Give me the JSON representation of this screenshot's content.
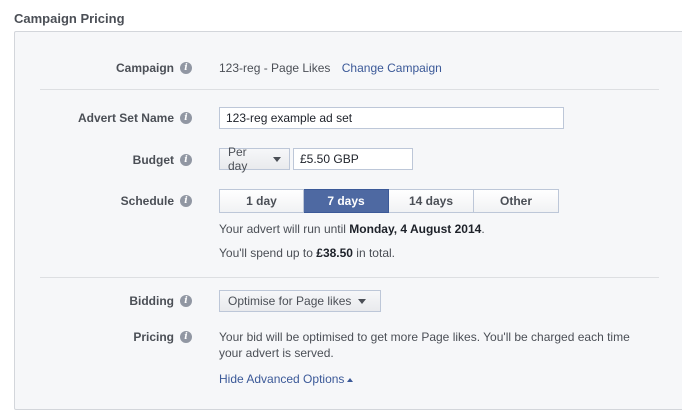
{
  "section_title": "Campaign Pricing",
  "campaign": {
    "label": "Campaign",
    "value": "123-reg - Page Likes",
    "change_link": "Change Campaign"
  },
  "advert_set": {
    "label": "Advert Set Name",
    "value": "123-reg example ad set"
  },
  "budget": {
    "label": "Budget",
    "type_selected": "Per day",
    "amount": "£5.50 GBP"
  },
  "schedule": {
    "label": "Schedule",
    "options": [
      "1 day",
      "7 days",
      "14 days",
      "Other"
    ],
    "selected": "7 days",
    "run_until_prefix": "Your advert will run until ",
    "run_until_date": "Monday, 4 August 2014",
    "run_until_suffix": ".",
    "spend_prefix": "You'll spend up to ",
    "spend_amount": "£38.50",
    "spend_suffix": " in total."
  },
  "bidding": {
    "label": "Bidding",
    "selected": "Optimise for Page likes"
  },
  "pricing": {
    "label": "Pricing",
    "line1": "Your bid will be optimised to get more Page likes. You'll be charged each time",
    "line2": "your advert is served.",
    "advanced_link": "Hide Advanced Options"
  },
  "colors": {
    "accent": "#3b5998",
    "active_segment": "#4e69a2",
    "panel_bg": "#f6f7f9"
  },
  "icons": {
    "info": "info-icon",
    "dropdown": "chevron-down-icon",
    "collapse": "chevron-up-icon"
  }
}
